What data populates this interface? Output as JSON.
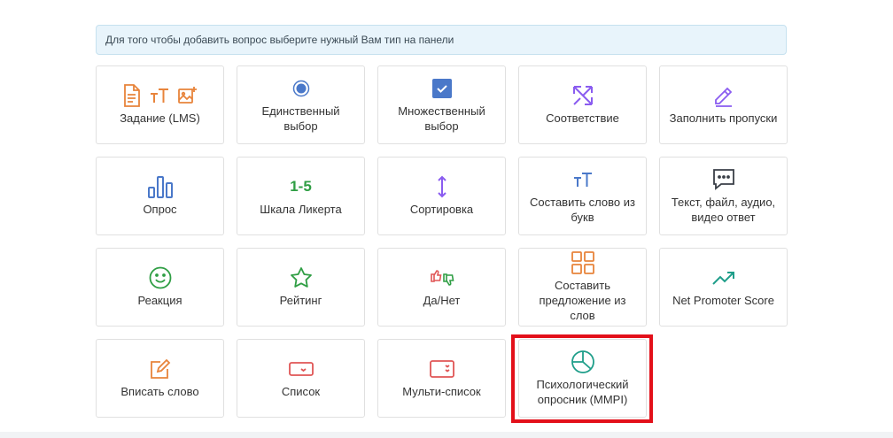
{
  "info_text": "Для того чтобы добавить вопрос выберите нужный Вам тип на панели",
  "colors": {
    "orange": "#e8843b",
    "blue": "#4a78c9",
    "purple": "#8a5cf0",
    "green": "#2f9e44",
    "red": "#e05555",
    "teal": "#1f9e8a",
    "highlight": "#e3101a"
  },
  "cards": [
    {
      "label": "Задание (LMS)",
      "icons": [
        "document-icon",
        "text-size-icon",
        "image-add-icon"
      ]
    },
    {
      "label": "Единственный выбор",
      "icons": [
        "radio-selected-icon"
      ]
    },
    {
      "label": "Множественный выбор",
      "icons": [
        "checkbox-checked-icon"
      ]
    },
    {
      "label": "Соответствие",
      "icons": [
        "arrows-match-icon"
      ]
    },
    {
      "label": "Заполнить пропуски",
      "icons": [
        "pencil-icon"
      ]
    },
    {
      "label": "Опрос",
      "icons": [
        "bar-chart-icon"
      ]
    },
    {
      "label": "Шкала Ликерта",
      "icon_text": "1-5"
    },
    {
      "label": "Сортировка",
      "icons": [
        "sort-vertical-icon"
      ]
    },
    {
      "label": "Составить слово из букв",
      "icons": [
        "text-size-icon"
      ]
    },
    {
      "label": "Текст, файл, аудио, видео ответ",
      "icons": [
        "message-icon"
      ]
    },
    {
      "label": "Реакция",
      "icons": [
        "smile-icon"
      ]
    },
    {
      "label": "Рейтинг",
      "icons": [
        "star-icon"
      ]
    },
    {
      "label": "Да/Нет",
      "icons": [
        "thumbs-icon"
      ]
    },
    {
      "label": "Составить предложение из слов",
      "icons": [
        "grid-icon"
      ]
    },
    {
      "label": "Net Promoter Score",
      "icons": [
        "trend-up-icon"
      ]
    },
    {
      "label": "Вписать слово",
      "icons": [
        "edit-box-icon"
      ]
    },
    {
      "label": "Список",
      "icons": [
        "dropdown-icon"
      ]
    },
    {
      "label": "Мульти-список",
      "icons": [
        "multi-dropdown-icon"
      ]
    },
    {
      "label": "Психологический опросник (MMPI)",
      "icons": [
        "pie-chart-icon"
      ],
      "highlighted": true
    }
  ]
}
